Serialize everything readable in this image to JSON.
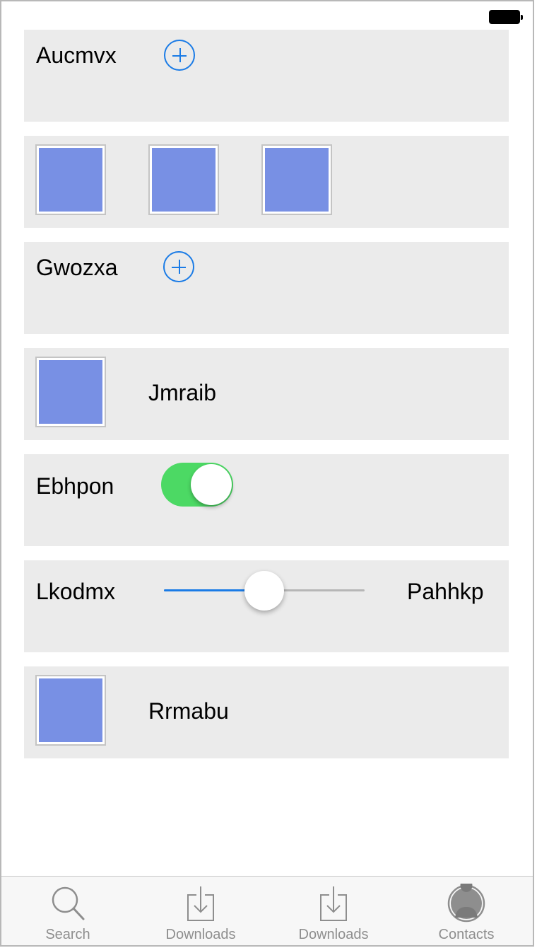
{
  "status": {
    "battery": "full"
  },
  "rows": {
    "row1": {
      "label": "Aucmvx",
      "icon": "plus-circle-icon"
    },
    "row2": {
      "thumbs": [
        "image",
        "image",
        "image"
      ]
    },
    "row3": {
      "label": "Gwozxa",
      "icon": "plus-circle-icon"
    },
    "row4": {
      "label": "Jmraib"
    },
    "row5": {
      "label": "Ebhpon",
      "toggle_on": true
    },
    "row6": {
      "label_left": "Lkodmx",
      "label_right": "Pahhkp",
      "slider_value": 0.5
    },
    "row7": {
      "label": "Rrmabu"
    }
  },
  "tabs": [
    {
      "label": "Search",
      "icon": "search-icon"
    },
    {
      "label": "Downloads",
      "icon": "download-icon"
    },
    {
      "label": "Downloads",
      "icon": "download-icon"
    },
    {
      "label": "Contacts",
      "icon": "contact-icon"
    }
  ],
  "colors": {
    "accent": "#1a7be6",
    "toggle_on": "#4cd964",
    "thumbnail": "#7890e4",
    "card_bg": "#ebebeb",
    "tab_inactive": "#8e8e8e"
  }
}
